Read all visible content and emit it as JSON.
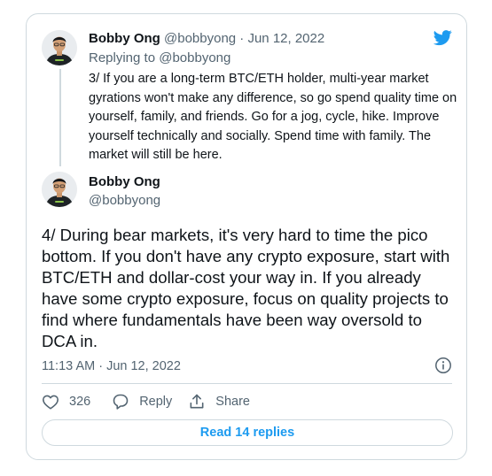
{
  "parent_tweet": {
    "author_name": "Bobby Ong",
    "author_handle": "@bobbyong",
    "separator": "·",
    "date": "Jun 12, 2022",
    "replying_prefix": "Replying to",
    "replying_to": "@bobbyong",
    "text": "3/ If you are a long-term BTC/ETH holder, multi-year market gyrations won't make any difference, so go spend quality time on yourself, family, and friends. Go for a jog, cycle, hike. Improve yourself technically and socially. Spend time with family. The market will still be here."
  },
  "main_tweet": {
    "author_name": "Bobby Ong",
    "author_handle": "@bobbyong",
    "text": "4/ During bear markets, it's very hard to time the pico bottom. If you don't have any crypto exposure, start with BTC/ETH and dollar-cost your way in. If you already have some crypto exposure, focus on quality projects to find where fundamentals have been way oversold to DCA in.",
    "timestamp": "11:13 AM · Jun 12, 2022"
  },
  "actions": {
    "like_count": "326",
    "reply_label": "Reply",
    "share_label": "Share"
  },
  "read_replies_label": "Read 14 replies",
  "icons": {
    "logo": "twitter-bird-icon",
    "info": "info-icon",
    "like": "heart-icon",
    "reply": "speech-bubble-icon",
    "share": "share-upload-icon"
  },
  "colors": {
    "accent": "#1d9bf0",
    "text": "#0f1419",
    "muted": "#536471",
    "border": "#cfd9de"
  }
}
